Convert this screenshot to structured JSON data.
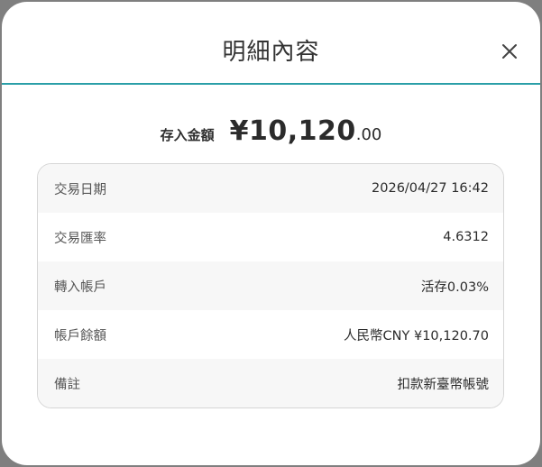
{
  "dialog": {
    "title": "明細內容",
    "close_icon": "close-icon"
  },
  "amount": {
    "label": "存入金額",
    "main": "¥10,120",
    "decimal": ".00"
  },
  "details": [
    {
      "label": "交易日期",
      "value": "2026/04/27 16:42"
    },
    {
      "label": "交易匯率",
      "value": "4.6312"
    },
    {
      "label": "轉入帳戶",
      "value": "活存0.03%"
    },
    {
      "label": "帳戶餘額",
      "value": "人民幣CNY ¥10,120.70"
    },
    {
      "label": "備註",
      "value": "扣款新臺幣帳號"
    }
  ],
  "colors": {
    "accent_line": "#2a9fa8",
    "overlay": "#7f7f7f"
  }
}
